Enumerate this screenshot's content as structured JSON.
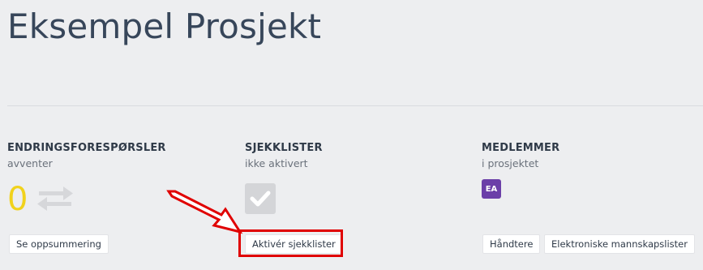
{
  "project": {
    "title": "Eksempel Prosjekt"
  },
  "cards": {
    "change_requests": {
      "title": "ENDRINGSFORESPØRSLER",
      "subtitle": "avventer",
      "count": "0",
      "icon": "swap-arrows-icon",
      "button_label": "Se oppsummering"
    },
    "checklists": {
      "title": "SJEKKLISTER",
      "subtitle": "ikke aktivert",
      "icon": "checkmark-icon",
      "button_label": "Aktivér sjekklister"
    },
    "members": {
      "title": "MEDLEMMER",
      "subtitle": "i prosjektet",
      "avatar_initials": "EA",
      "buttons": [
        "Håndtere",
        "Elektroniske mannskapslister"
      ]
    }
  },
  "colors": {
    "count": "#f1d21c",
    "avatar": "#6b3fa8",
    "highlight": "#e00000"
  }
}
